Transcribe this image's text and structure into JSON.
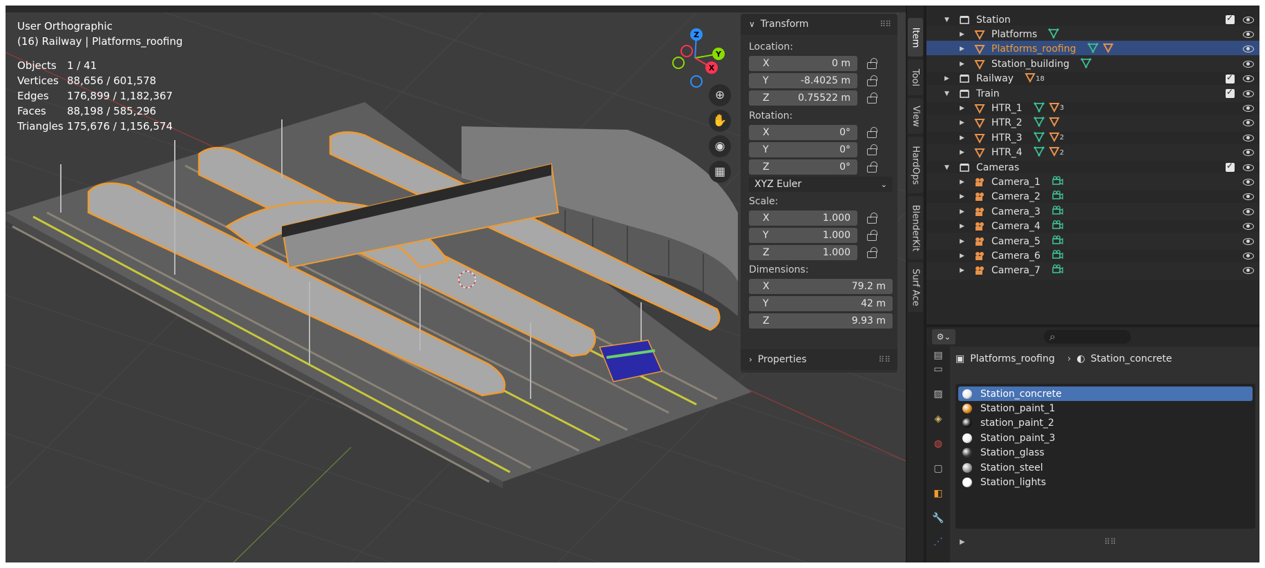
{
  "viewport": {
    "view_name": "User Orthographic",
    "collection_path": "(16) Railway | Platforms_roofing",
    "stats": [
      {
        "label": "Objects",
        "value": "1 / 41"
      },
      {
        "label": "Vertices",
        "value": "88,656 / 601,578"
      },
      {
        "label": "Edges",
        "value": "176,899 / 1,182,367"
      },
      {
        "label": "Faces",
        "value": "88,198 / 585,296"
      },
      {
        "label": "Triangles",
        "value": "175,676 / 1,156,574"
      }
    ],
    "gizmo": {
      "x": "X",
      "y": "Y",
      "z": "Z"
    }
  },
  "npanel": {
    "transform_title": "Transform",
    "location_label": "Location:",
    "location": [
      {
        "axis": "X",
        "value": "0 m"
      },
      {
        "axis": "Y",
        "value": "-8.4025 m"
      },
      {
        "axis": "Z",
        "value": "0.75522 m"
      }
    ],
    "rotation_label": "Rotation:",
    "rotation": [
      {
        "axis": "X",
        "value": "0°"
      },
      {
        "axis": "Y",
        "value": "0°"
      },
      {
        "axis": "Z",
        "value": "0°"
      }
    ],
    "rotation_mode": "XYZ Euler",
    "scale_label": "Scale:",
    "scale": [
      {
        "axis": "X",
        "value": "1.000"
      },
      {
        "axis": "Y",
        "value": "1.000"
      },
      {
        "axis": "Z",
        "value": "1.000"
      }
    ],
    "dimensions_label": "Dimensions:",
    "dimensions": [
      {
        "axis": "X",
        "value": "79.2 m"
      },
      {
        "axis": "Y",
        "value": "42 m"
      },
      {
        "axis": "Z",
        "value": "9.93 m"
      }
    ],
    "properties_title": "Properties"
  },
  "sidetabs": [
    "Item",
    "Tool",
    "View",
    "HardOps",
    "BlenderKit",
    "Surf Ace"
  ],
  "outliner": {
    "rows": [
      {
        "label": "Station",
        "kind": "collection"
      },
      {
        "label": "Platforms",
        "kind": "mesh"
      },
      {
        "label": "Platforms_roofing",
        "kind": "mesh"
      },
      {
        "label": "Station_building",
        "kind": "mesh"
      },
      {
        "label": "Railway",
        "kind": "collection",
        "count": "18"
      },
      {
        "label": "Train",
        "kind": "collection"
      },
      {
        "label": "HTR_1",
        "kind": "mesh",
        "count": "3"
      },
      {
        "label": "HTR_2",
        "kind": "mesh"
      },
      {
        "label": "HTR_3",
        "kind": "mesh",
        "count": "2"
      },
      {
        "label": "HTR_4",
        "kind": "mesh",
        "count": "2"
      },
      {
        "label": "Cameras",
        "kind": "collection"
      },
      {
        "label": "Camera_1",
        "kind": "camera"
      },
      {
        "label": "Camera_2",
        "kind": "camera"
      },
      {
        "label": "Camera_3",
        "kind": "camera"
      },
      {
        "label": "Camera_4",
        "kind": "camera"
      },
      {
        "label": "Camera_5",
        "kind": "camera"
      },
      {
        "label": "Camera_6",
        "kind": "camera"
      },
      {
        "label": "Camera_7",
        "kind": "camera"
      }
    ]
  },
  "properties": {
    "breadcrumb_object": "Platforms_roofing",
    "breadcrumb_material": "Station_concrete",
    "materials": [
      {
        "name": "Station_concrete",
        "color": "#e8e8e8"
      },
      {
        "name": "Station_paint_1",
        "color": "#e08a1e"
      },
      {
        "name": "station_paint_2",
        "color": "#1a1a1a"
      },
      {
        "name": "Station_paint_3",
        "color": "#f2f2f2"
      },
      {
        "name": "Station_glass",
        "color": "#3a3a3a"
      },
      {
        "name": "Station_steel",
        "color": "#9a9a9a"
      },
      {
        "name": "Station_lights",
        "color": "#ffffff"
      }
    ]
  },
  "colors": {
    "selection_orange": "#f29a2e",
    "mesh_icon_orange": "#e8924a",
    "data_icon_green": "#3fbf95",
    "outliner_selected": "#334d80",
    "material_selected": "#4772b3"
  }
}
